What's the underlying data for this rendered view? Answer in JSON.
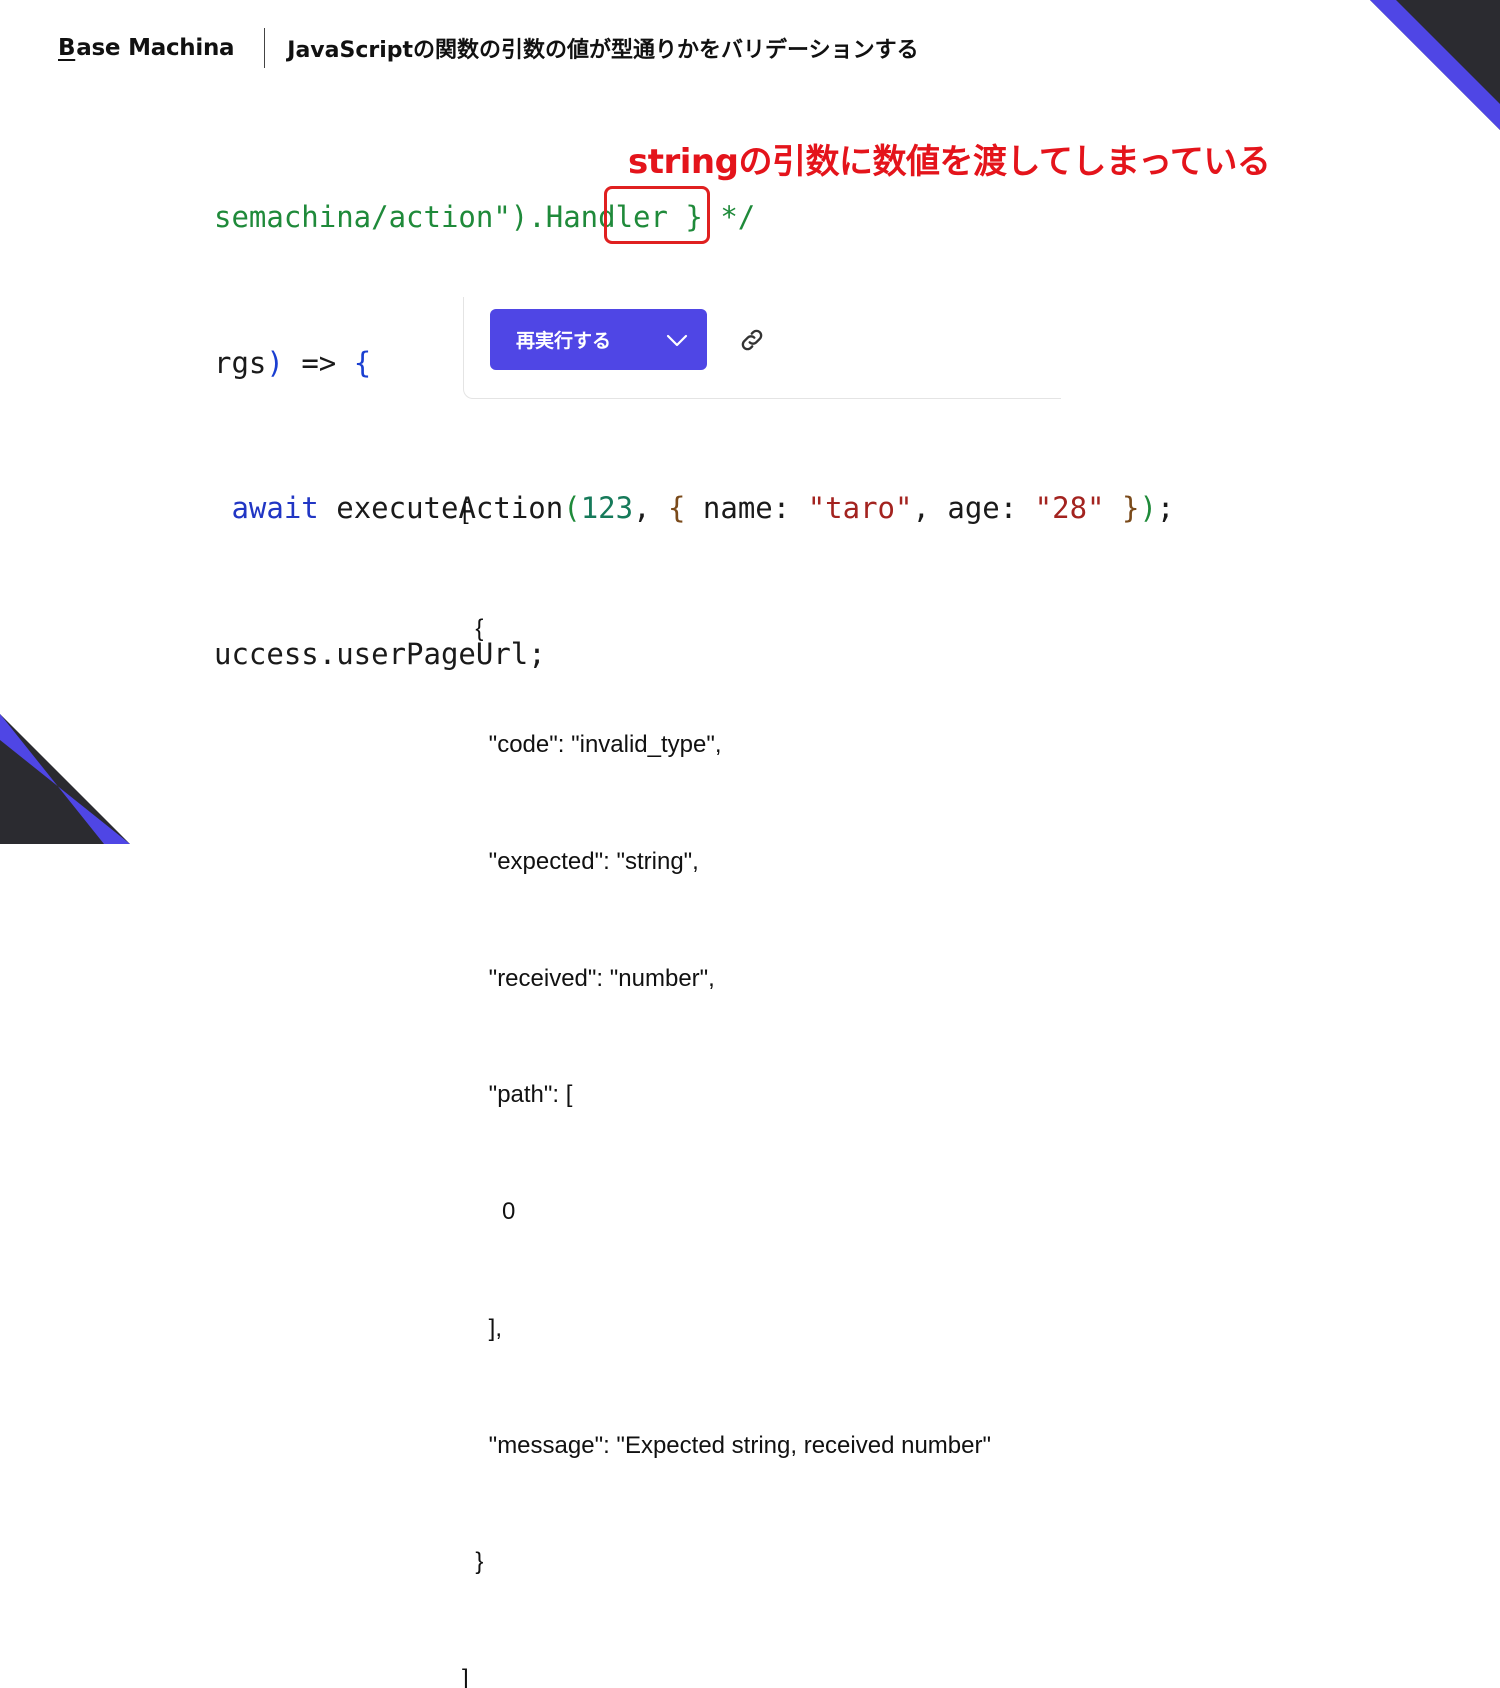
{
  "header": {
    "brand_prefix": "B",
    "brand_rest": "ase",
    "brand_second": "Machina",
    "title": "JavaScriptの関数の引数の値が型通りかをバリデーションする"
  },
  "code": {
    "line1": {
      "p1": "semachina/action\").Handler } */"
    },
    "line2": {
      "p1": "rgs",
      "p2": ")",
      "p3": " => ",
      "p4": "{"
    },
    "line3": {
      "p0": " ",
      "p1": "await",
      "p2": " executeAction",
      "p3": "(",
      "p4": "123",
      "p5": ", ",
      "p6": "{",
      "p7": " name: ",
      "p8": "\"taro\"",
      "p9": ", age: ",
      "p10": "\"28\"",
      "p11": " ",
      "p12": "}",
      "p13": ")",
      "p14": ";"
    },
    "line4": {
      "p1": "uccess.userPageUrl;"
    }
  },
  "annotation": "stringの引数に数値を渡してしまっている",
  "toolbar": {
    "rerun_label": "再実行する",
    "dropdown_icon": "chevron-down-icon",
    "link_icon": "link-icon",
    "accent": "#4f46e5"
  },
  "output": {
    "lines": [
      "[",
      "  {",
      "    \"code\": \"invalid_type\",",
      "    \"expected\": \"string\",",
      "    \"received\": \"number\",",
      "    \"path\": [",
      "      0",
      "    ],",
      "    \"message\": \"Expected string, received number\"",
      "  }",
      "]"
    ]
  },
  "colors": {
    "corner_accent": "#4f46e5",
    "corner_dark": "#2b2b30",
    "annotation_red": "#e4141b"
  }
}
